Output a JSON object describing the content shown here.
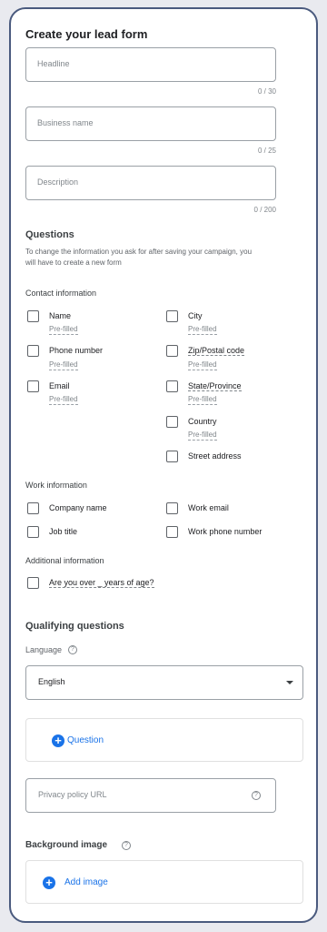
{
  "form": {
    "title": "Create your lead form",
    "headline": {
      "placeholder": "Headline",
      "counter": "0 / 30"
    },
    "business_name": {
      "placeholder": "Business name",
      "counter": "0 / 25"
    },
    "description": {
      "placeholder": "Description",
      "counter": "0 / 200"
    }
  },
  "questions": {
    "title": "Questions",
    "help": "To change the information you ask for after saving your campaign, you will have to create a new form",
    "contact_title": "Contact information",
    "prefilled_label": "Pre-filled",
    "contact_left": [
      {
        "label": "Name",
        "prefilled": "Pre-filled",
        "checked": false
      },
      {
        "label": "Phone number",
        "prefilled": "Pre-filled",
        "checked": false
      },
      {
        "label": "Email",
        "prefilled": "Pre-filled",
        "checked": false
      }
    ],
    "contact_right": [
      {
        "label": "City",
        "prefilled": "Pre-filled",
        "checked": false
      },
      {
        "label": "Zip/Postal code",
        "prefilled": "Pre-filled",
        "checked": false
      },
      {
        "label": "State/Province",
        "prefilled": "Pre-filled",
        "checked": false
      },
      {
        "label": "Country",
        "prefilled": "Pre-filled",
        "checked": false
      },
      {
        "label": "Street address",
        "checked": false
      }
    ],
    "work_title": "Work information",
    "work": [
      {
        "label": "Company name",
        "checked": false
      },
      {
        "label": "Work email",
        "checked": false
      },
      {
        "label": "Job title",
        "checked": false
      },
      {
        "label": "Work phone number",
        "checked": false
      }
    ],
    "additional_title": "Additional information",
    "additional": [
      {
        "label": "Are you over _ years of age?",
        "checked": false
      }
    ]
  },
  "qualifying": {
    "title": "Qualifying questions",
    "language_label": "Language",
    "language_value": "English",
    "add_question": "Question"
  },
  "privacy": {
    "placeholder": "Privacy policy URL"
  },
  "background": {
    "title": "Background image",
    "add_image": "Add image"
  },
  "colors": {
    "accent": "#1a73e8",
    "frame": "#4a5a7e"
  }
}
